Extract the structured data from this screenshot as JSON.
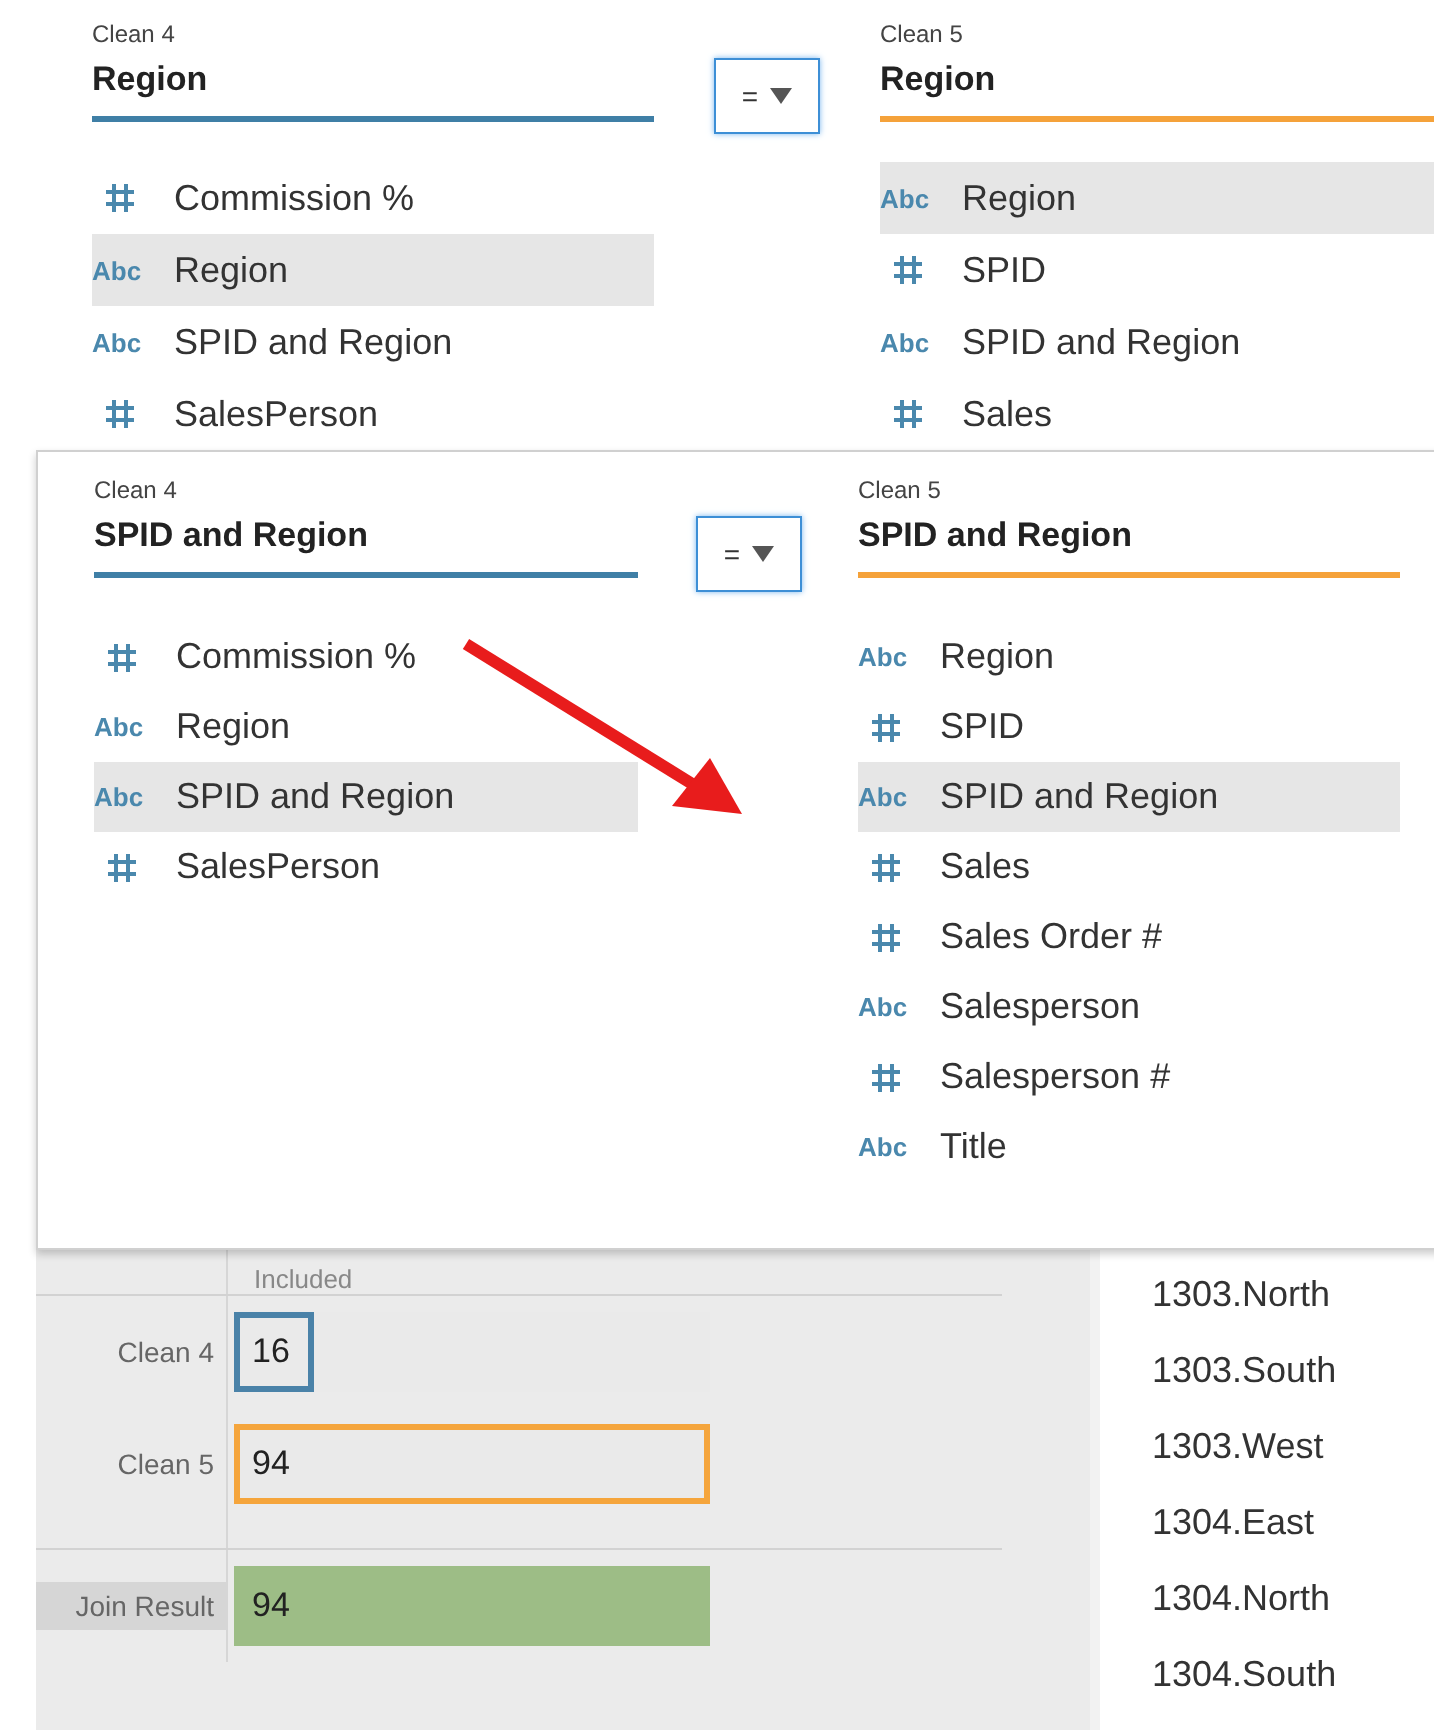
{
  "join_clauses": [
    {
      "left": {
        "source": "Clean 4",
        "field": "Region",
        "fields": [
          {
            "kind": "number",
            "name": "Commission %",
            "selected": false
          },
          {
            "kind": "string",
            "glyph": "Abc",
            "name": "Region",
            "selected": true
          },
          {
            "kind": "string",
            "glyph": "Abc",
            "name": "SPID and Region",
            "selected": false
          },
          {
            "kind": "number",
            "name": "SalesPerson",
            "selected": false
          }
        ]
      },
      "operator": "=",
      "right": {
        "source": "Clean 5",
        "field": "Region",
        "fields": [
          {
            "kind": "string",
            "glyph": "Abc",
            "name": "Region",
            "selected": true
          },
          {
            "kind": "number",
            "name": "SPID",
            "selected": false
          },
          {
            "kind": "string",
            "glyph": "Abc",
            "name": "SPID and Region",
            "selected": false
          },
          {
            "kind": "number",
            "name": "Sales",
            "selected": false
          }
        ]
      }
    },
    {
      "left": {
        "source": "Clean 4",
        "field": "SPID and Region",
        "fields": [
          {
            "kind": "number",
            "name": "Commission %",
            "selected": false
          },
          {
            "kind": "string",
            "glyph": "Abc",
            "name": "Region",
            "selected": false
          },
          {
            "kind": "string",
            "glyph": "Abc",
            "name": "SPID and Region",
            "selected": true
          },
          {
            "kind": "number",
            "name": "SalesPerson",
            "selected": false
          }
        ]
      },
      "operator": "=",
      "right": {
        "source": "Clean 5",
        "field": "SPID and Region",
        "fields": [
          {
            "kind": "string",
            "glyph": "Abc",
            "name": "Region",
            "selected": false
          },
          {
            "kind": "number",
            "name": "SPID",
            "selected": false
          },
          {
            "kind": "string",
            "glyph": "Abc",
            "name": "SPID and Region",
            "selected": true
          },
          {
            "kind": "number",
            "name": "Sales",
            "selected": false
          },
          {
            "kind": "number",
            "name": "Sales Order #",
            "selected": false
          },
          {
            "kind": "string",
            "glyph": "Abc",
            "name": "Salesperson",
            "selected": false
          },
          {
            "kind": "number",
            "name": "Salesperson #",
            "selected": false
          },
          {
            "kind": "string",
            "glyph": "Abc",
            "name": "Title",
            "selected": false
          }
        ]
      }
    }
  ],
  "summary": {
    "column_header": "Included",
    "rows": [
      {
        "label": "Clean 4",
        "value": "16",
        "level": 0.17,
        "kind": "outline",
        "color": "#4a82a8",
        "selected": false
      },
      {
        "label": "Clean 5",
        "value": "94",
        "level": 1,
        "kind": "outline",
        "color": "#f5a53c",
        "selected": false
      },
      {
        "label": "Join Result",
        "value": "94",
        "level": 1,
        "kind": "filled",
        "color": "#9dbd86",
        "selected": true
      }
    ]
  },
  "values": [
    "1303.North",
    "1303.South",
    "1303.West",
    "1304.East",
    "1304.North",
    "1304.South"
  ]
}
